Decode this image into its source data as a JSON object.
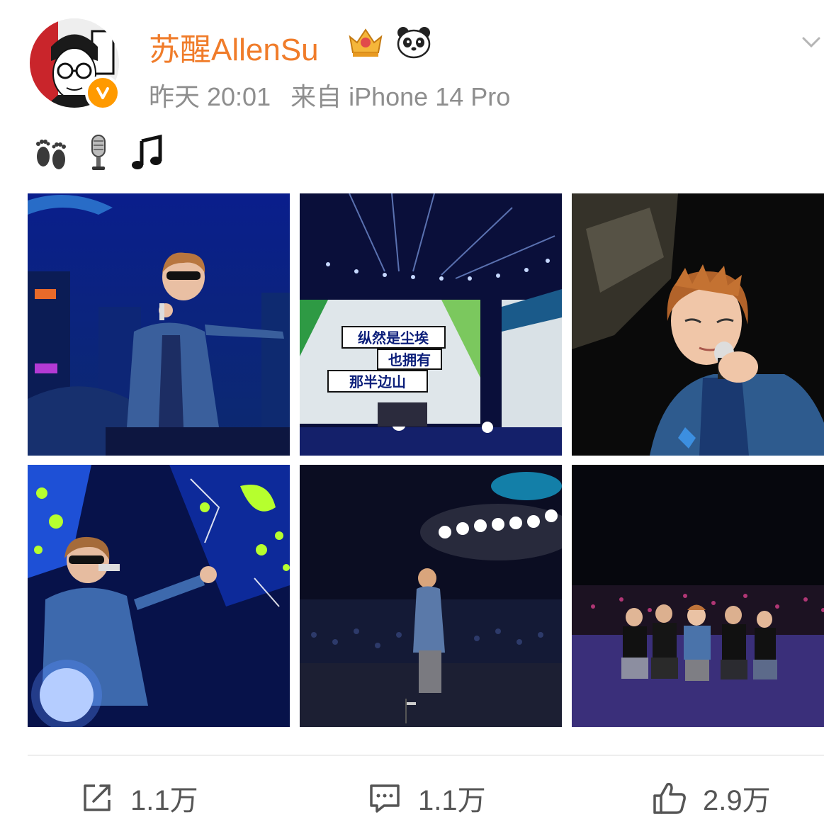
{
  "post": {
    "user_name": "苏醒AllenSu",
    "timestamp": "昨天 20:01",
    "source": "来自 iPhone 14 Pro",
    "content_emojis": [
      "footprints-icon",
      "microphone-icon",
      "music-note-icon"
    ],
    "badges": [
      "crown-badge-icon",
      "panda-badge-icon"
    ],
    "photos": [
      {
        "name": "photo-singer-blue-stage"
      },
      {
        "name": "photo-stage-screens",
        "screen_lines": [
          "纵然是尘埃",
          "也拥有",
          "那半边山"
        ]
      },
      {
        "name": "photo-singer-closeup"
      },
      {
        "name": "photo-singer-green-screen"
      },
      {
        "name": "photo-singer-facing-crowd"
      },
      {
        "name": "photo-band-group"
      }
    ]
  },
  "actions": {
    "repost_count": "1.1万",
    "comment_count": "1.1万",
    "like_count": "2.9万"
  },
  "colors": {
    "name_orange": "#f07c2a",
    "meta_gray": "#8e8e8e",
    "verified_orange": "#ff9a00"
  }
}
